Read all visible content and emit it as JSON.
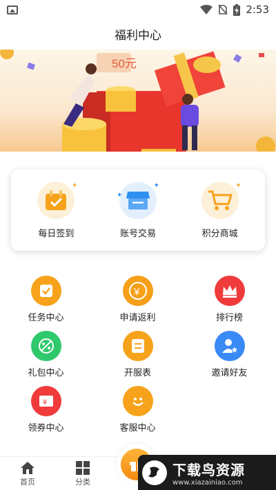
{
  "status_bar": {
    "time": "2:53",
    "icons": [
      "image-icon",
      "wifi-icon",
      "no-sim-icon",
      "battery-charging-icon"
    ]
  },
  "header": {
    "title": "福利中心"
  },
  "banner": {
    "badge_text": "50元",
    "icon": "gift-box-illustration"
  },
  "quick_actions": [
    {
      "label": "每日签到",
      "icon": "calendar-check-icon"
    },
    {
      "label": "账号交易",
      "icon": "store-icon"
    },
    {
      "label": "积分商城",
      "icon": "shopping-cart-icon"
    }
  ],
  "grid": [
    {
      "label": "任务中心",
      "icon": "task-check-icon",
      "color": "#f7a21b"
    },
    {
      "label": "申请返利",
      "icon": "yen-coin-icon",
      "color": "#f5a018"
    },
    {
      "label": "排行榜",
      "icon": "crown-icon",
      "color": "#ef3b3b"
    },
    {
      "label": "礼包中心",
      "icon": "gift-tag-icon",
      "color": "#2ec96b"
    },
    {
      "label": "开服表",
      "icon": "schedule-icon",
      "color": "#f7a21b"
    },
    {
      "label": "邀请好友",
      "icon": "invite-user-icon",
      "color": "#3a8af5"
    },
    {
      "label": "领券中心",
      "icon": "coupon-icon",
      "color": "#ef3b3b"
    },
    {
      "label": "客服中心",
      "icon": "smile-icon",
      "color": "#f7a21b"
    }
  ],
  "bottom_nav": [
    {
      "label": "首页",
      "icon": "home-icon"
    },
    {
      "label": "分类",
      "icon": "category-icon"
    }
  ],
  "watermark": {
    "main": "下载鸟资源",
    "sub": "www.xiazainiao.com"
  }
}
